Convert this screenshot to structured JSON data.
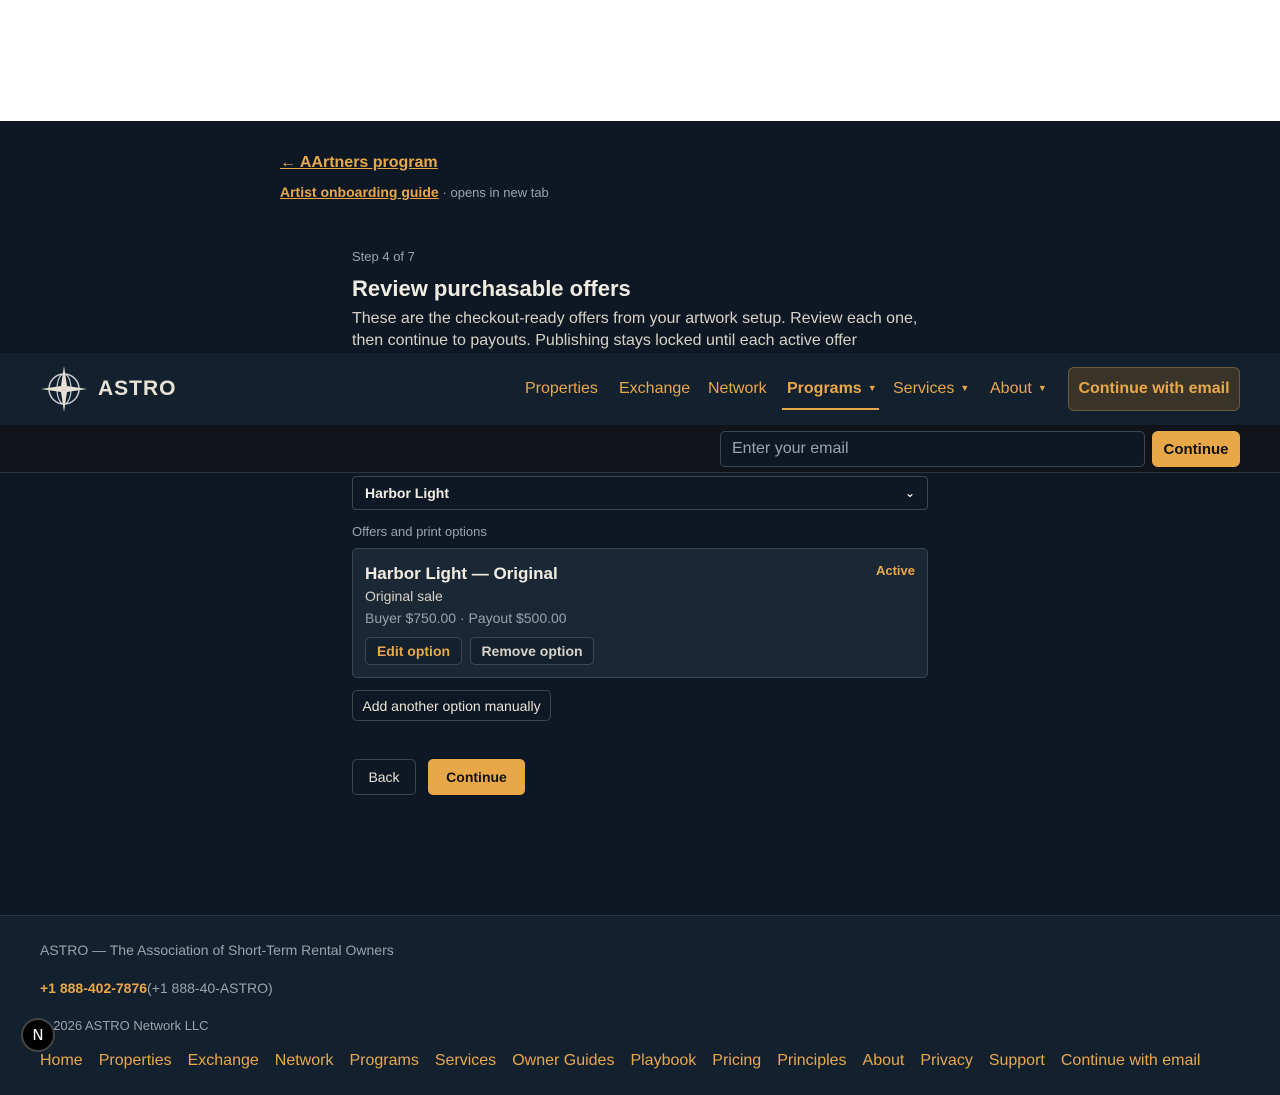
{
  "header": {
    "back_link": "← AArtners program",
    "guide_link": "Artist onboarding guide",
    "guide_note": "· opens in new tab"
  },
  "step": {
    "label": "Step 4 of 7",
    "title": "Review purchasable offers",
    "description": "These are the checkout-ready offers from your artwork setup. Review each one, then continue to payouts. Publishing stays locked until each active offer"
  },
  "navbar": {
    "brand": "ASTRO",
    "logo_icon": "compass-star-icon",
    "items": [
      {
        "label": "Properties"
      },
      {
        "label": "Exchange"
      },
      {
        "label": "Network"
      },
      {
        "label": "Programs",
        "dropdown": true,
        "active": true
      },
      {
        "label": "Services",
        "dropdown": true
      },
      {
        "label": "About",
        "dropdown": true
      }
    ],
    "caret": "▼",
    "cta_label": "Continue with email"
  },
  "email_bar": {
    "placeholder": "Enter your email",
    "button_label": "Continue"
  },
  "artwork_select": {
    "selected": "Harbor Light",
    "chevron": "⌄"
  },
  "offers": {
    "section_label": "Offers and print options",
    "card": {
      "title": "Harbor Light — Original",
      "status": "Active",
      "type": "Original sale",
      "price": "Buyer $750.00 · Payout $500.00",
      "edit_label": "Edit option",
      "remove_label": "Remove option"
    },
    "add_label": "Add another option manually"
  },
  "actions": {
    "back_label": "Back",
    "continue_label": "Continue"
  },
  "footer": {
    "org": "ASTRO — The Association of Short-Term Rental Owners",
    "phone": "+1 888-402-7876",
    "phone_alt": "(+1 888-40-ASTRO)",
    "copyright": "© 2026 ASTRO Network LLC",
    "links": [
      "Home",
      "Properties",
      "Exchange",
      "Network",
      "Programs",
      "Services",
      "Owner Guides",
      "Playbook",
      "Pricing",
      "Principles",
      "About",
      "Privacy",
      "Support",
      "Continue with email"
    ]
  },
  "dev_badge": "N",
  "colors": {
    "accent": "#e8a84a",
    "background": "#0d1824",
    "surface": "#1a2734"
  }
}
